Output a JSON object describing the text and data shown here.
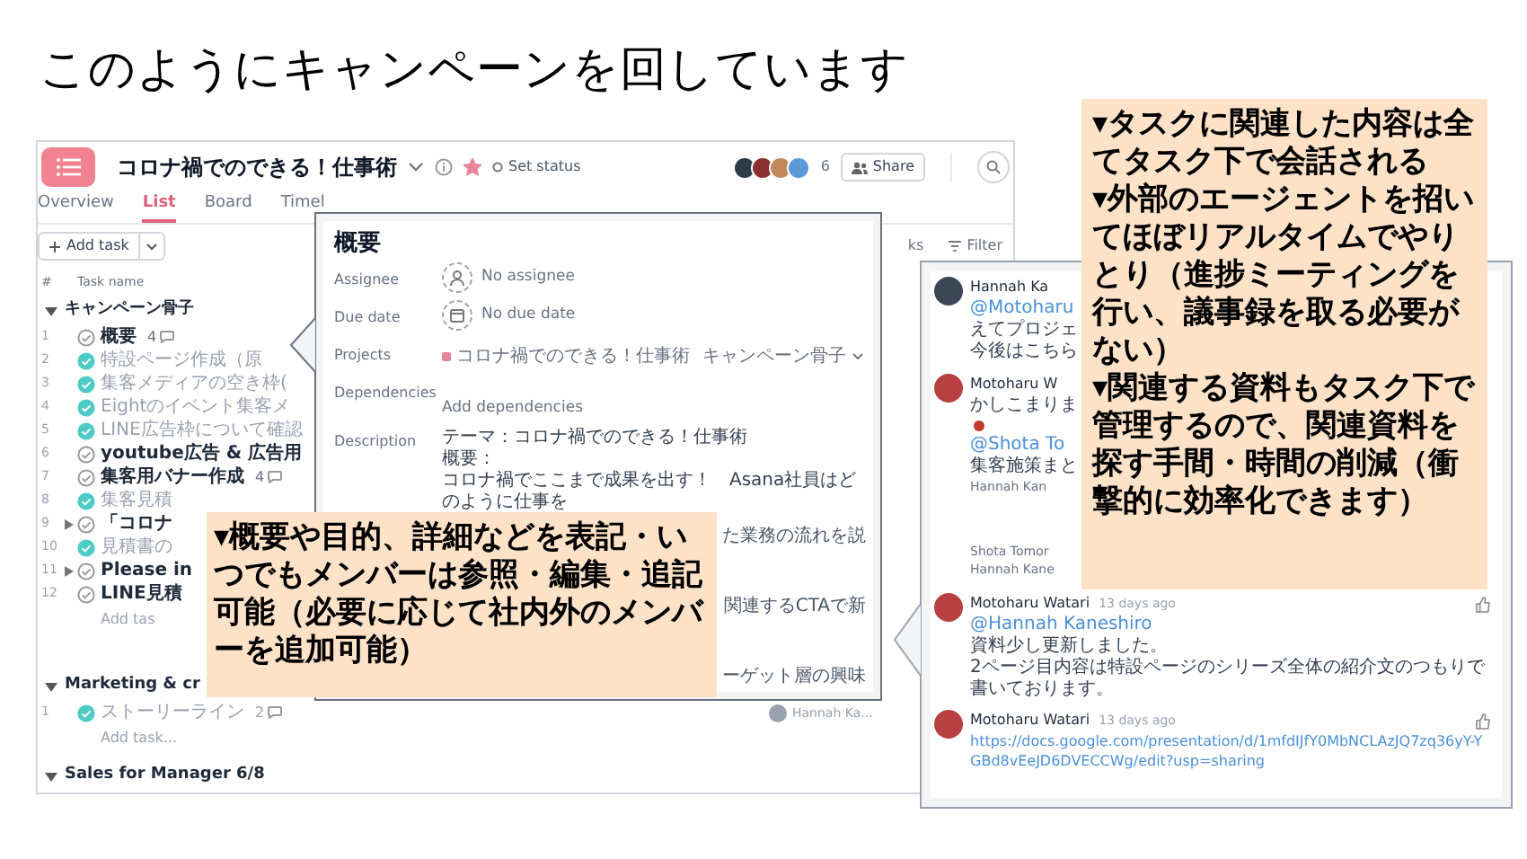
{
  "slide_title": "このようにキャンペーンを回しています",
  "project": {
    "title": "コロナ禍でのできる！仕事術",
    "starred": true,
    "set_status": "Set status",
    "member_count": "6",
    "share": "Share",
    "tabs": [
      {
        "label": "Overview",
        "selected": false
      },
      {
        "label": "List",
        "selected": true
      },
      {
        "label": "Board",
        "selected": false
      },
      {
        "label": "Timel",
        "selected": false
      }
    ],
    "add_task": "Add task",
    "toolbar_fragment": "ks",
    "filter": "Filter",
    "columns": [
      "#",
      "Task name"
    ],
    "sections": [
      {
        "name": "キャンペーン骨子",
        "expanded": true,
        "add_task": "Add tas",
        "tasks": [
          {
            "number": "1",
            "name": "概要",
            "completed": false,
            "subtasks": false,
            "comments": "4"
          },
          {
            "number": "2",
            "name": "特設ページ作成（原",
            "completed": true,
            "subtasks": false
          },
          {
            "number": "3",
            "name": "集客メディアの空き枠(",
            "completed": true,
            "subtasks": false
          },
          {
            "number": "4",
            "name": "Eightのイベント集客メ",
            "completed": true,
            "subtasks": false
          },
          {
            "number": "5",
            "name": "LINE広告枠について確認",
            "completed": true,
            "subtasks": false
          },
          {
            "number": "6",
            "name": "youtube広告 & 広告用",
            "completed": false,
            "subtasks": false
          },
          {
            "number": "7",
            "name": "集客用バナー作成",
            "completed": false,
            "subtasks": false,
            "comments": "4"
          },
          {
            "number": "8",
            "name": "集客見積",
            "completed": true,
            "subtasks": false
          },
          {
            "number": "9",
            "name": "「コロナ",
            "completed": false,
            "subtasks": true
          },
          {
            "number": "10",
            "name": "見積書の",
            "completed": true,
            "subtasks": false
          },
          {
            "number": "11",
            "name": "Please in",
            "completed": false,
            "subtasks": true
          },
          {
            "number": "12",
            "name": "LINE見積",
            "completed": false,
            "subtasks": false
          }
        ]
      },
      {
        "name": "Marketing & cr",
        "expanded": true,
        "add_task": "Add task...",
        "tasks": [
          {
            "number": "1",
            "name": "ストーリーライン",
            "completed": true,
            "subtasks": false,
            "comments": "2"
          }
        ]
      },
      {
        "name": "Sales for Manager 6/8",
        "expanded": true
      }
    ]
  },
  "detail_panel": {
    "title": "概要",
    "fields": [
      {
        "kind": "assignee",
        "label": "Assignee",
        "value": "No assignee"
      },
      {
        "kind": "due_date",
        "label": "Due date",
        "value": "No due date"
      },
      {
        "kind": "projects",
        "label": "Projects",
        "project": "コロナ禍でのできる！仕事術",
        "section": "キャンペーン骨子"
      },
      {
        "kind": "link",
        "label": "Dependencies",
        "value": "Add dependencies"
      },
      {
        "kind": "description",
        "label": "Description",
        "lines": [
          "テーマ：コロナ禍でのできる！仕事術",
          "概要：",
          "コロナ禍でここまで成果を出す！　Asana社員はどのように仕事を"
        ]
      }
    ],
    "fragments": [
      "た業務の流れを説",
      "関連するCTAで新",
      "ーゲット層の興味"
    ]
  },
  "assignee_chip": "Hannah Ka...",
  "comments": [
    {
      "kind": "comment",
      "author": "Hannah Ka",
      "lines": [
        {
          "kind": "mention",
          "text": "@Motoharu"
        },
        {
          "kind": "text",
          "text": "えてプロジェ"
        },
        {
          "kind": "text",
          "text": "今後はこちら"
        }
      ]
    },
    {
      "kind": "comment",
      "author": "Motoharu W",
      "lines": [
        {
          "kind": "text",
          "text": "かしこまりま"
        },
        {
          "kind": "emoji"
        },
        {
          "kind": "mention",
          "text": "@Shota To"
        },
        {
          "kind": "text",
          "text": "集客施策まと"
        },
        {
          "kind": "meta",
          "text": "Hannah Kan"
        }
      ]
    },
    {
      "kind": "activity",
      "lines": [
        {
          "kind": "meta",
          "text": "Shota Tomor"
        },
        {
          "kind": "meta",
          "text": "Hannah Kane"
        }
      ]
    },
    {
      "kind": "comment",
      "author": "Motoharu Watari",
      "time": "13 days ago",
      "like_button": true,
      "lines": [
        {
          "kind": "mention",
          "text": "@Hannah Kaneshiro"
        },
        {
          "kind": "text",
          "text": "資料少し更新しました。"
        },
        {
          "kind": "text",
          "text": "2ページ目内容は特設ページのシリーズ全体の紹介文のつもりで書いております。"
        }
      ]
    },
    {
      "kind": "comment",
      "author": "Motoharu Watari",
      "time": "13 days ago",
      "like_button": true,
      "lines": [
        {
          "kind": "link",
          "text": "https://docs.google.com/presentation/d/1mfdIJfY0MbNCLAzJQ7zq36yY-YGBd8vEeJD6DVECCWg/edit?usp=sharing"
        }
      ]
    }
  ],
  "callouts": [
    {
      "paragraphs": [
        "▾タスクに関連した内容は全てタスク下で会話される",
        "▾外部のエージェントを招いてほぼリアルタイムでやりとり（進捗ミーティングを行い、議事録を取る必要がない）",
        "▾関連する資料もタスク下で管理するので、関連資料を探す手間・時間の削減（衝撃的に効率化できます）"
      ]
    },
    {
      "paragraphs": [
        "▾概要や目的、詳細などを表記・いつでもメンバーは参照・編集・追記可能（必要に応じて社内外のメンバーを追加可能）"
      ]
    }
  ]
}
